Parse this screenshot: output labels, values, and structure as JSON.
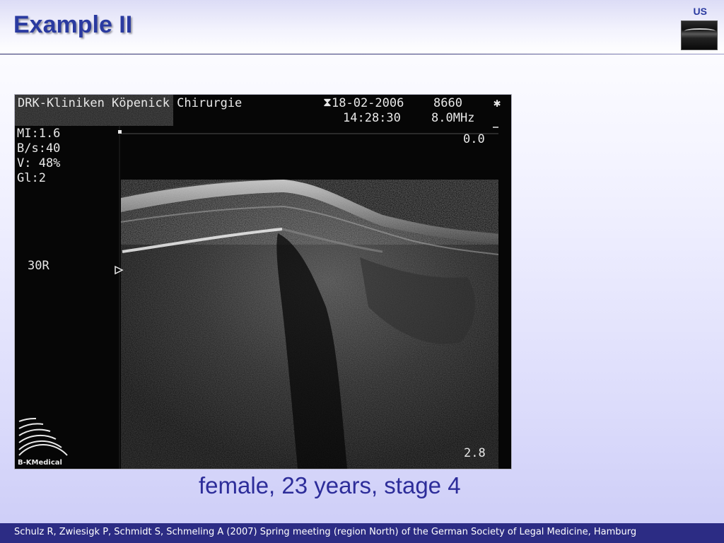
{
  "slide": {
    "title": "Example II",
    "corner_tag": "US",
    "caption": "female, 23 years, stage 4",
    "footer": "Schulz R, Zwiesigk P, Schmidt S, Schmeling A (2007) Spring meeting (region North) of the German Society of Legal Medicine, Hamburg"
  },
  "ultrasound": {
    "header_left": "DRK-Kliniken Köpenick Chirurgie",
    "date": "18-02-2006",
    "id": "8660",
    "star": "✱",
    "time": "14:28:30",
    "frequency": "8.0MHz",
    "depth_marker": "0.0",
    "params": [
      "MI:1.6",
      "B/s:40",
      "V: 48%",
      "Gl:2"
    ],
    "side_label": "30R",
    "scale_bottom": "2.8",
    "brand": "B-KMedical"
  },
  "colors": {
    "title": "#2a3aa0",
    "caption": "#2d2d9a",
    "footer_bg": "#2c2c84"
  }
}
